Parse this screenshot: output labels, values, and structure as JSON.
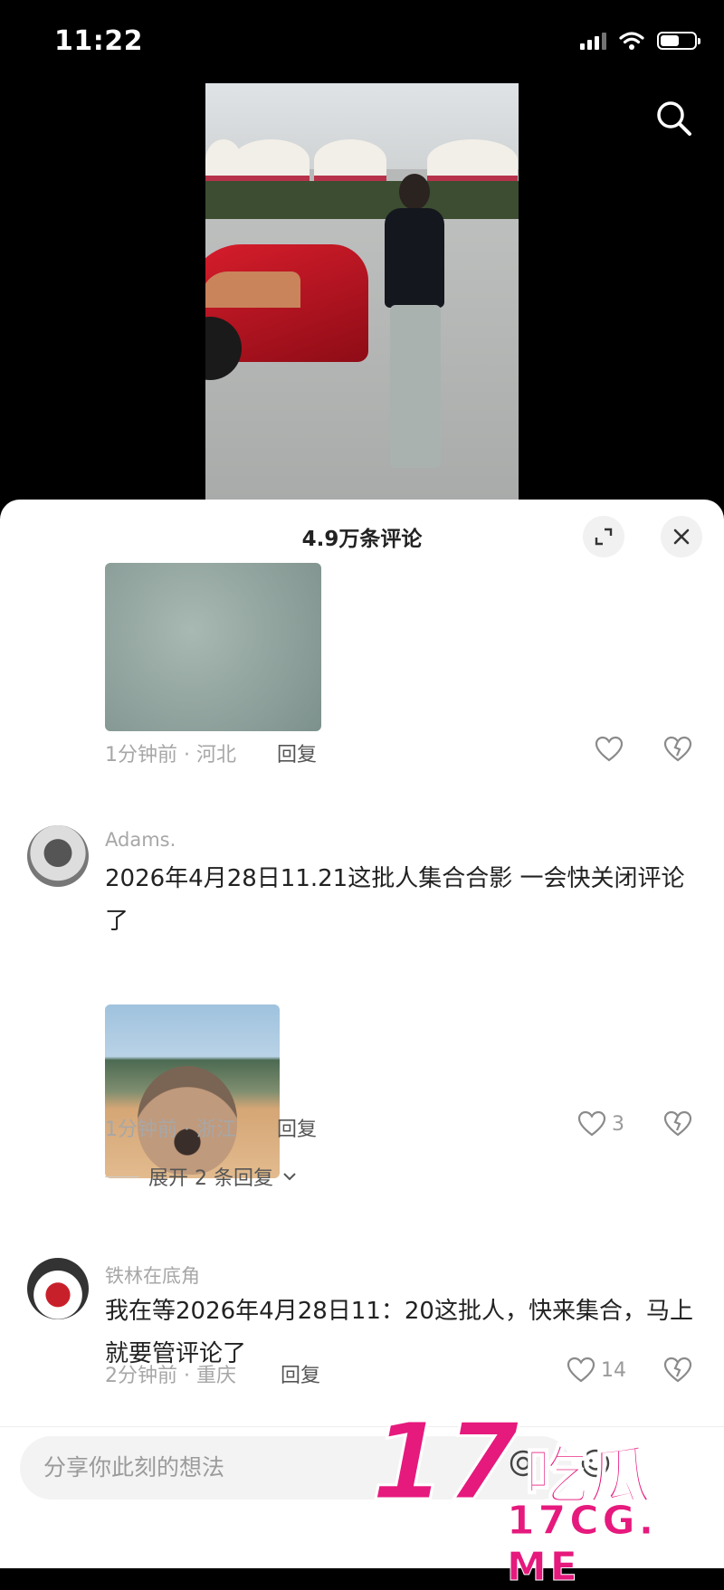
{
  "status": {
    "time": "11:22",
    "battery_level": 0.55
  },
  "sheet": {
    "title": "4.9万条评论"
  },
  "comments": [
    {
      "meta": "1分钟前 · 河北",
      "reply": "回复",
      "likes": ""
    },
    {
      "username": "Adams.",
      "text": "2026年4月28日11.21这批人集合合影 一会快关闭评论了",
      "meta": "1分钟前 · 浙江",
      "reply": "回复",
      "likes": "3",
      "expand": "展开 2 条回复"
    },
    {
      "username": "铁林在底角",
      "text": "我在等2026年4月28日11：20这批人，快来集合，马上就要管评论了",
      "meta": "2分钟前 · 重庆",
      "reply": "回复",
      "likes": "14"
    }
  ],
  "input": {
    "placeholder": "分享你此刻的想法"
  },
  "watermark": {
    "main": "17",
    "cn": "吃瓜",
    "sub": "17CG. ME"
  },
  "icons": [
    "signal-icon",
    "wifi-icon",
    "battery-icon",
    "search-icon",
    "expand-icon",
    "close-icon",
    "heart-icon",
    "dislike-icon",
    "chevron-down-icon",
    "at-icon",
    "emoji-icon"
  ]
}
